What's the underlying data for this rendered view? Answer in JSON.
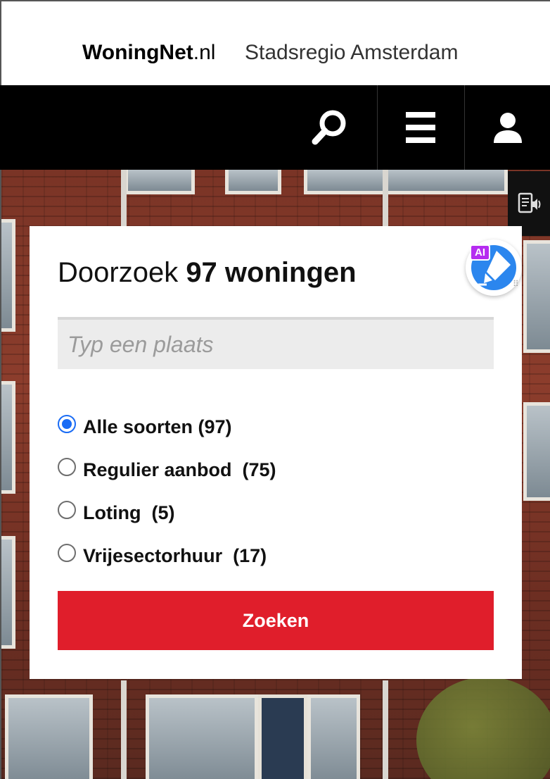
{
  "header": {
    "brand_bold": "WoningNet",
    "brand_suffix": ".nl",
    "region": "Stadsregio Amsterdam"
  },
  "nav": {
    "icons": [
      "search-icon",
      "menu-icon",
      "user-icon"
    ]
  },
  "search_card": {
    "title_lead": "Doorzoek ",
    "title_strong": "97 woningen",
    "place_placeholder": "Typ een plaats",
    "options": [
      {
        "label": "Alle soorten (97)",
        "checked": true
      },
      {
        "label": "Regulier aanbod  (75)",
        "checked": false
      },
      {
        "label": "Loting  (5)",
        "checked": false
      },
      {
        "label": "Vrijesectorhuur  (17)",
        "checked": false
      }
    ],
    "submit_label": "Zoeken"
  },
  "ai_widget": {
    "badge": "AI"
  },
  "colors": {
    "accent_red": "#e01e2b",
    "radio_blue": "#1a6cf5",
    "ai_purple": "#b52cf0",
    "ai_blue": "#2b86ee"
  }
}
